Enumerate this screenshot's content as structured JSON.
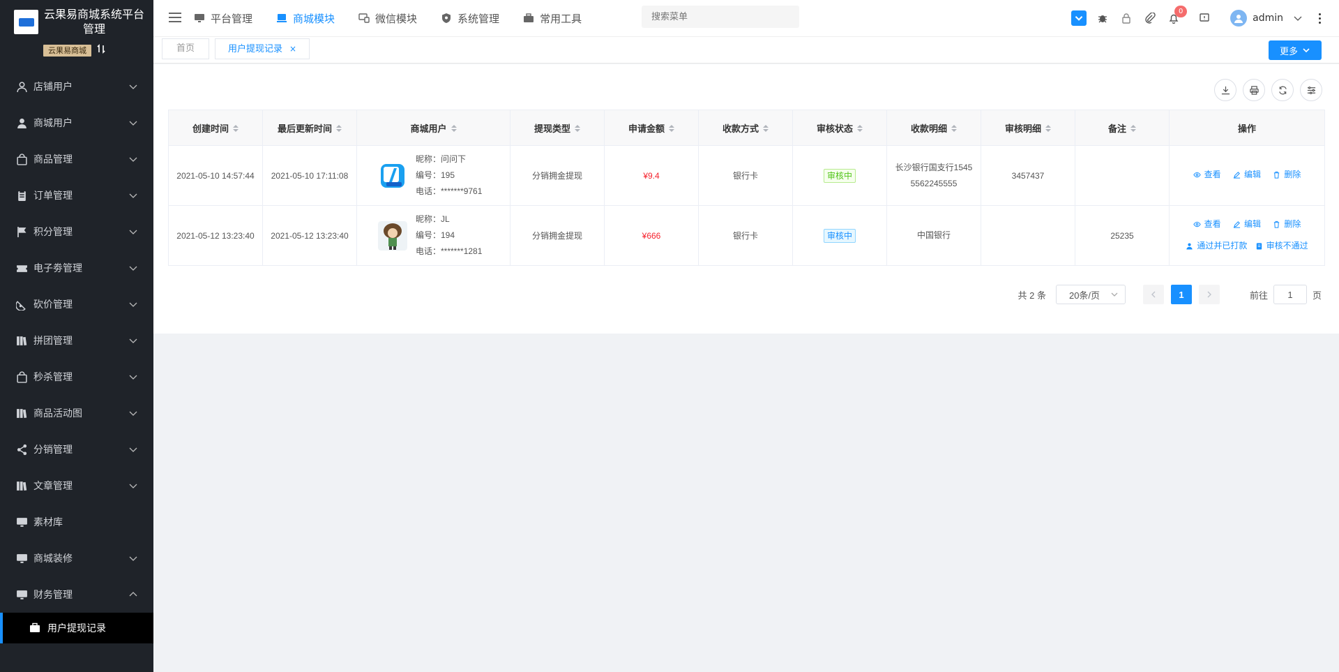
{
  "sidebar": {
    "title": "云果易商城系统平台管理",
    "store_tag": "云果易商城",
    "menu": [
      {
        "label": "店铺用户",
        "icon": "user-outline-icon"
      },
      {
        "label": "商城用户",
        "icon": "user-filled-icon"
      },
      {
        "label": "商品管理",
        "icon": "bag-icon"
      },
      {
        "label": "订单管理",
        "icon": "clipboard-icon"
      },
      {
        "label": "积分管理",
        "icon": "flag-icon"
      },
      {
        "label": "电子劵管理",
        "icon": "ticket-icon"
      },
      {
        "label": "砍价管理",
        "icon": "watermelon-icon"
      },
      {
        "label": "拼团管理",
        "icon": "books-icon"
      },
      {
        "label": "秒杀管理",
        "icon": "bag-icon"
      },
      {
        "label": "商品活动图",
        "icon": "books-icon"
      },
      {
        "label": "分销管理",
        "icon": "share-icon"
      },
      {
        "label": "文章管理",
        "icon": "books-icon"
      },
      {
        "label": "素材库",
        "icon": "monitor-icon"
      },
      {
        "label": "商城装修",
        "icon": "monitor-icon"
      },
      {
        "label": "财务管理",
        "icon": "monitor-icon"
      }
    ],
    "submenu_active": "用户提现记录"
  },
  "topbar": {
    "nav": [
      {
        "label": "平台管理",
        "icon": "monitor-icon"
      },
      {
        "label": "商城模块",
        "icon": "shop-icon"
      },
      {
        "label": "微信模块",
        "icon": "wechat-icon"
      },
      {
        "label": "系统管理",
        "icon": "shield-icon"
      },
      {
        "label": "常用工具",
        "icon": "toolbox-icon"
      }
    ],
    "search_placeholder": "搜索菜单",
    "notification_count": "0",
    "username": "admin"
  },
  "tags": {
    "home": "首页",
    "active": "用户提现记录",
    "more_label": "更多"
  },
  "table": {
    "headers": [
      "创建时间",
      "最后更新时间",
      "商城用户",
      "提现类型",
      "申请金额",
      "收款方式",
      "审核状态",
      "收款明细",
      "审核明细",
      "备注",
      "操作"
    ],
    "rows": [
      {
        "created": "2021-05-10 14:57:44",
        "updated": "2021-05-10 17:11:08",
        "nickname": "昵称：问问下",
        "number": "编号：195",
        "phone": "电话：*******9761",
        "type": "分销拥金提现",
        "amount": "¥9.4",
        "method": "银行卡",
        "status": "审核中",
        "receipt_line1": "长沙银行国支行1545",
        "receipt_line2": "5562245555",
        "audit": "3457437",
        "remark": "",
        "ops": [
          "查看",
          "编辑",
          "删除"
        ],
        "extra_ops": []
      },
      {
        "created": "2021-05-12 13:23:40",
        "updated": "2021-05-12 13:23:40",
        "nickname": "昵称：JL",
        "number": "编号：194",
        "phone": "电话：*******1281",
        "type": "分销拥金提现",
        "amount": "¥666",
        "method": "银行卡",
        "status": "审核中",
        "receipt_line1": "中国银行",
        "receipt_line2": "",
        "audit": "",
        "remark": "25235",
        "ops": [
          "查看",
          "编辑",
          "删除"
        ],
        "extra_ops": [
          "通过并已打款",
          "审核不通过"
        ]
      }
    ]
  },
  "pagination": {
    "total": "共 2 条",
    "page_size": "20条/页",
    "current_page": "1",
    "goto_label": "前往",
    "goto_value": "1",
    "page_suffix": "页"
  },
  "colors": {
    "accent": "#1890ff",
    "sidebar_bg": "#1f2329",
    "amount_red": "#f5222d",
    "status_green": "#52c41a"
  }
}
